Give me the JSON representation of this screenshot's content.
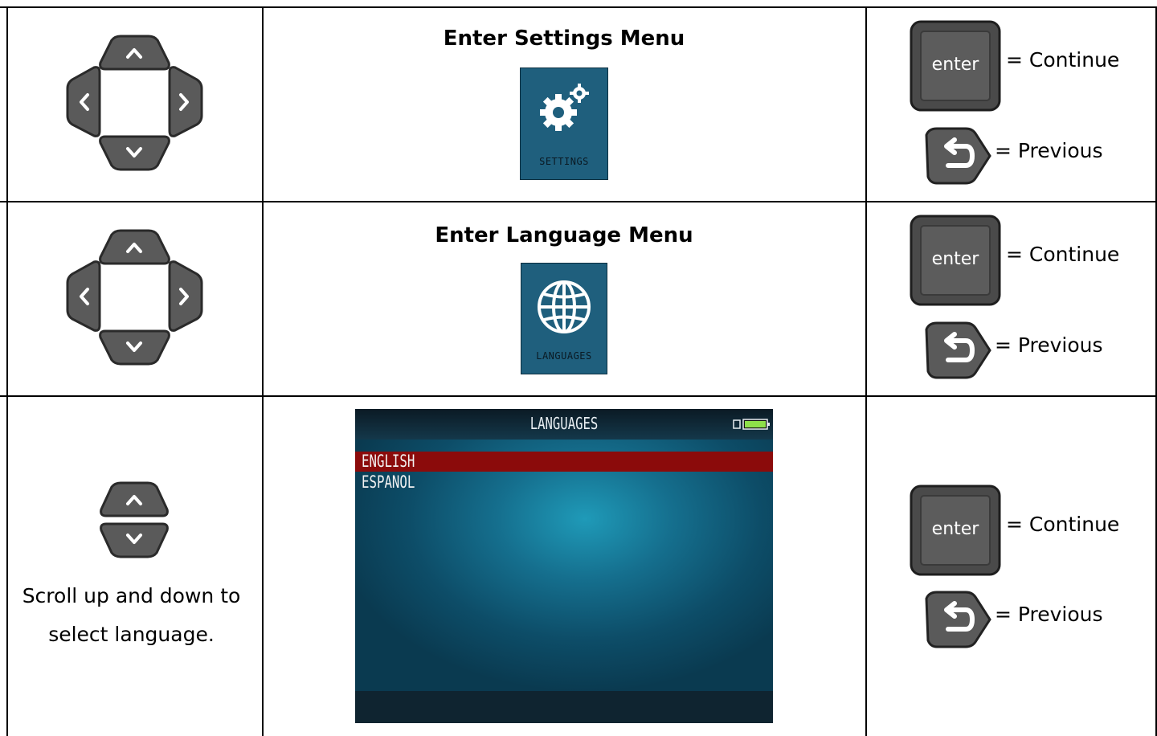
{
  "rows": [
    {
      "title": "Enter Settings Menu",
      "nav_keys": "dpad-four-way",
      "menu_icon": {
        "name": "gear-icon",
        "label": "SETTINGS"
      },
      "actions": {
        "enter_key_label": "enter",
        "continue_text": "= Continue",
        "previous_text": "= Previous"
      }
    },
    {
      "title": "Enter Language Menu",
      "nav_keys": "dpad-four-way",
      "menu_icon": {
        "name": "globe-icon",
        "label": "LANGUAGES"
      },
      "actions": {
        "enter_key_label": "enter",
        "continue_text": "= Continue",
        "previous_text": "= Previous"
      }
    },
    {
      "nav_keys": "up-down-keys",
      "caption_line1": "Scroll up and down to",
      "caption_line2": "select language.",
      "screen": {
        "title": "LANGUAGES",
        "items": [
          {
            "label": "ENGLISH",
            "selected": true
          },
          {
            "label": "ESPANOL",
            "selected": false
          }
        ]
      },
      "actions": {
        "enter_key_label": "enter",
        "continue_text": "= Continue",
        "previous_text": "= Previous"
      }
    }
  ],
  "colors": {
    "key_fill": "#5a5a5a",
    "key_border": "#2a2a2a",
    "icon_tile": "#1f5f7d",
    "selected_row": "#8b0b0b"
  }
}
